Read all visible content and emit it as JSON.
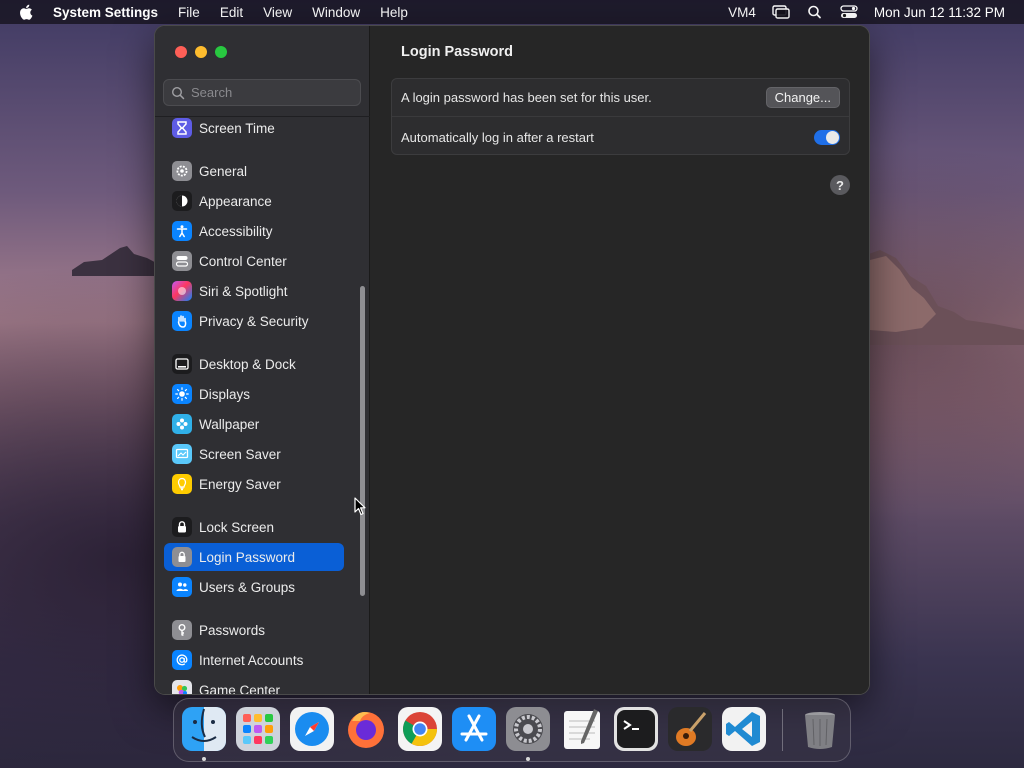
{
  "menubar": {
    "app_name": "System Settings",
    "menus": [
      "File",
      "Edit",
      "View",
      "Window",
      "Help"
    ],
    "user": "VM4",
    "clock": "Mon Jun 12  11:32 PM"
  },
  "sidebar": {
    "search_placeholder": "Search",
    "items": [
      {
        "label": "Screen Time",
        "icon": "hourglass-icon",
        "color": "#5e5ce6"
      },
      {
        "label": "General",
        "icon": "gear-icon",
        "color": "#8e8e93"
      },
      {
        "label": "Appearance",
        "icon": "appearance-icon",
        "color": "#1c1c1e"
      },
      {
        "label": "Accessibility",
        "icon": "accessibility-icon",
        "color": "#0a84ff"
      },
      {
        "label": "Control Center",
        "icon": "control-center-icon",
        "color": "#8e8e93"
      },
      {
        "label": "Siri & Spotlight",
        "icon": "siri-icon",
        "color": "#bf5af2"
      },
      {
        "label": "Privacy & Security",
        "icon": "hand-icon",
        "color": "#0a84ff"
      },
      {
        "label": "Desktop & Dock",
        "icon": "desktop-dock-icon",
        "color": "#1c1c1e"
      },
      {
        "label": "Displays",
        "icon": "sun-icon",
        "color": "#0a84ff"
      },
      {
        "label": "Wallpaper",
        "icon": "wallpaper-icon",
        "color": "#30b0e8"
      },
      {
        "label": "Screen Saver",
        "icon": "screen-saver-icon",
        "color": "#5ac8fa"
      },
      {
        "label": "Energy Saver",
        "icon": "battery-icon",
        "color": "#ffcc00"
      },
      {
        "label": "Lock Screen",
        "icon": "lock-icon",
        "color": "#1c1c1e"
      },
      {
        "label": "Login Password",
        "icon": "lock-small-icon",
        "color": "#8e8e93"
      },
      {
        "label": "Users & Groups",
        "icon": "users-icon",
        "color": "#0a84ff"
      },
      {
        "label": "Passwords",
        "icon": "key-icon",
        "color": "#8e8e93"
      },
      {
        "label": "Internet Accounts",
        "icon": "at-icon",
        "color": "#0a84ff"
      },
      {
        "label": "Game Center",
        "icon": "game-center-icon",
        "color": "#e5e5ea"
      }
    ],
    "active": "Login Password"
  },
  "content": {
    "title": "Login Password",
    "password_row": {
      "label": "A login password has been set for this user.",
      "button_label": "Change..."
    },
    "autologin_row": {
      "label": "Automatically log in after a restart",
      "enabled": true
    },
    "help_label": "?"
  },
  "dock": {
    "apps": [
      "Finder",
      "Launchpad",
      "Safari",
      "Firefox",
      "Chrome",
      "App Store",
      "System Settings",
      "TextEdit",
      "Terminal",
      "GarageBand",
      "Visual Studio Code",
      "Trash"
    ],
    "running": [
      "Finder",
      "System Settings"
    ]
  },
  "colors": {
    "accent": "#0a5fd6",
    "toggle_on": "#1f6fe8",
    "window_bg": "#262626",
    "sidebar_bg": "#2f2f33"
  }
}
